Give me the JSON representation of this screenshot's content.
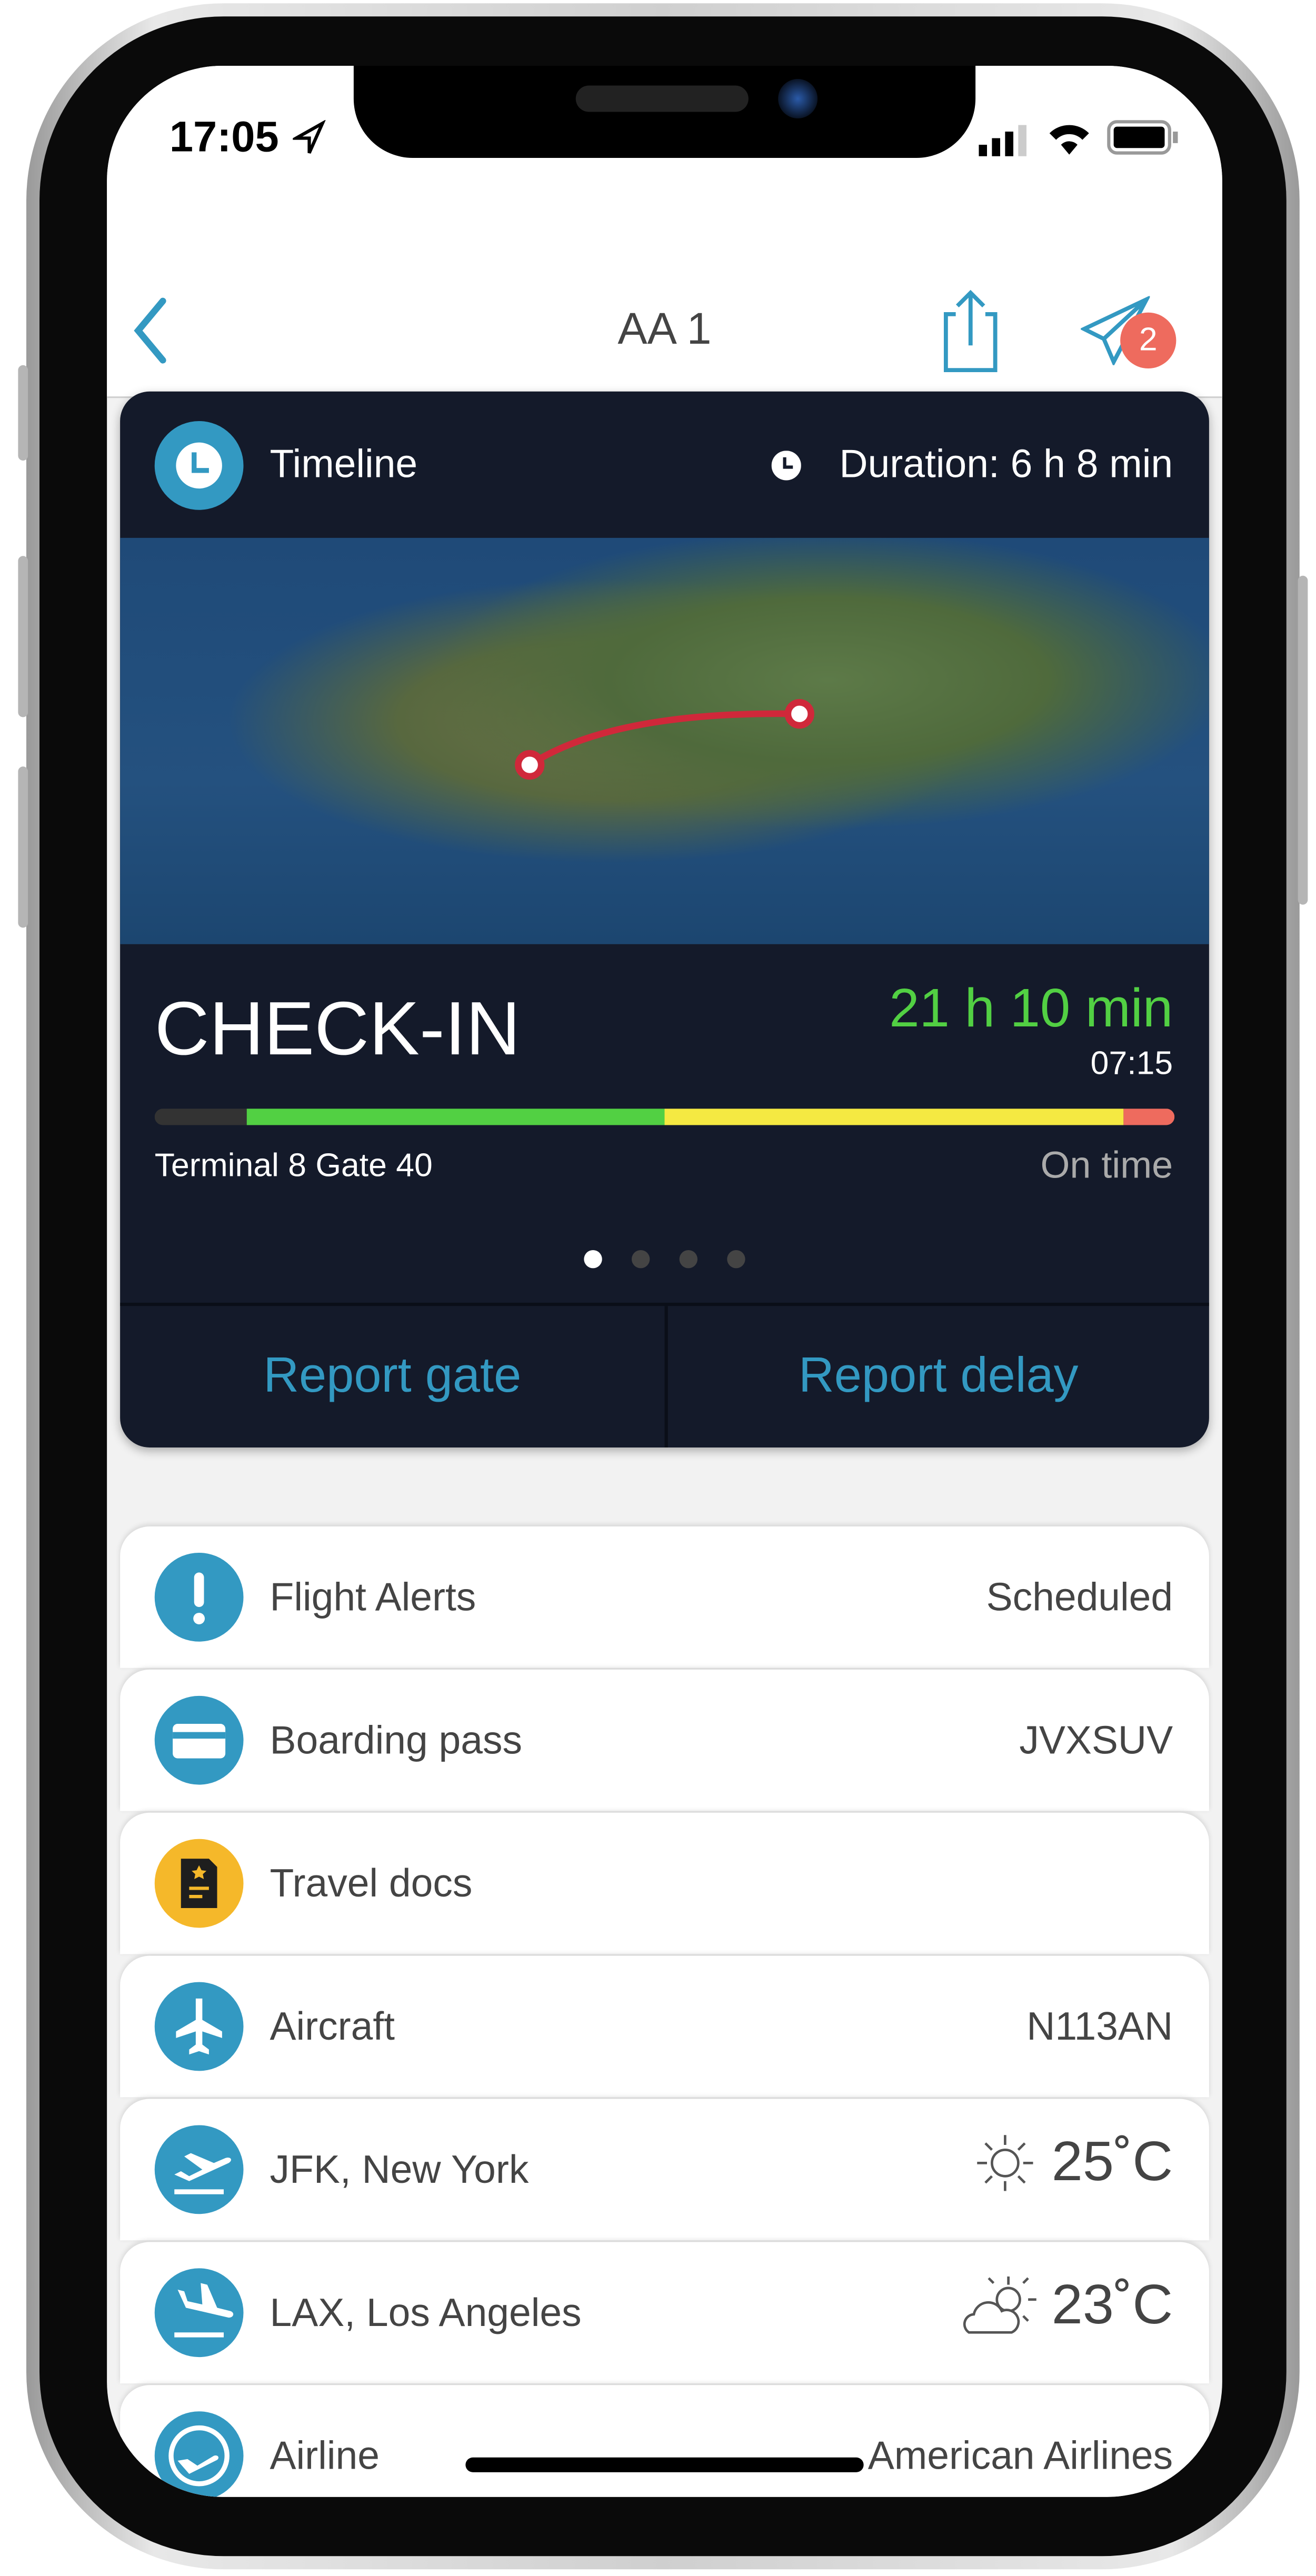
{
  "status": {
    "time": "17:05"
  },
  "nav": {
    "title": "AA 1",
    "badge": "2"
  },
  "timeline": {
    "header": "Timeline",
    "duration": "Duration: 6 h 8 min",
    "phase": "CHECK-IN",
    "countdown": "21 h 10 min",
    "time": "07:15",
    "gate": "Terminal 8 Gate 40",
    "status": "On time",
    "progress_segments": [
      {
        "color": "#333333",
        "fraction": 0.09
      },
      {
        "color": "#52d043",
        "fraction": 0.41
      },
      {
        "color": "#f5e942",
        "fraction": 0.45
      },
      {
        "color": "#ee6b5e",
        "fraction": 0.05
      }
    ],
    "page_index": 0,
    "page_count": 4,
    "report_gate": "Report gate",
    "report_delay": "Report delay"
  },
  "colors": {
    "accent": "#3399c2",
    "countdown": "#52d043",
    "badge": "#ee6b5e",
    "docs": "#f5b82a"
  },
  "rows": [
    {
      "icon": "alert-icon",
      "label": "Flight Alerts",
      "value": "Scheduled"
    },
    {
      "icon": "card-icon",
      "label": "Boarding pass",
      "value": "JVXSUV"
    },
    {
      "icon": "document-icon",
      "label": "Travel docs",
      "value": ""
    },
    {
      "icon": "airplane-icon",
      "label": "Aircraft",
      "value": "N113AN"
    },
    {
      "icon": "takeoff-icon",
      "label": "JFK, New York",
      "value": "25˚C",
      "weather": "sunny-icon"
    },
    {
      "icon": "landing-icon",
      "label": "LAX, Los Angeles",
      "value": "23˚C",
      "weather": "partly-cloudy-icon"
    },
    {
      "icon": "airline-icon",
      "label": "Airline",
      "value": "American Airlines"
    }
  ]
}
